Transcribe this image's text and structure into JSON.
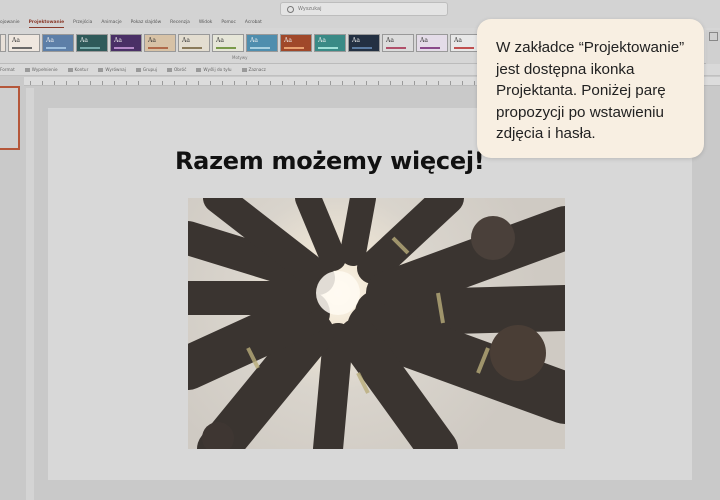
{
  "window": {
    "search_placeholder": "Wyszukaj"
  },
  "ribbon": {
    "tabs": [
      "Projektowanie",
      "Przejścia",
      "Animacje",
      "Pokaz slajdów",
      "Recenzja",
      "Widok",
      "Pomoc",
      "Acrobat"
    ],
    "group_label": "Motywy",
    "theme_glyph": "Aa"
  },
  "toolbar": {
    "items": [
      "Format",
      "Wypełnienie",
      "Kontur",
      "Wyrównaj",
      "Grupuj",
      "Obróć",
      "Wyślij do tyłu",
      "Zaznacz"
    ]
  },
  "slide": {
    "title": "Razem możemy więcej!",
    "image_alt": "photo of firefighters stacking hands"
  },
  "callout": {
    "text": "W zakładce “Projektowanie” jest dostępna ikonka Projektanta. Poniżej parę propozycji po wstawieniu zdjęcia i hasła."
  },
  "colors": {
    "accent": "#8a3a2a",
    "callout_bg": "#f8efe2",
    "selected_thumb": "#b5573a"
  }
}
